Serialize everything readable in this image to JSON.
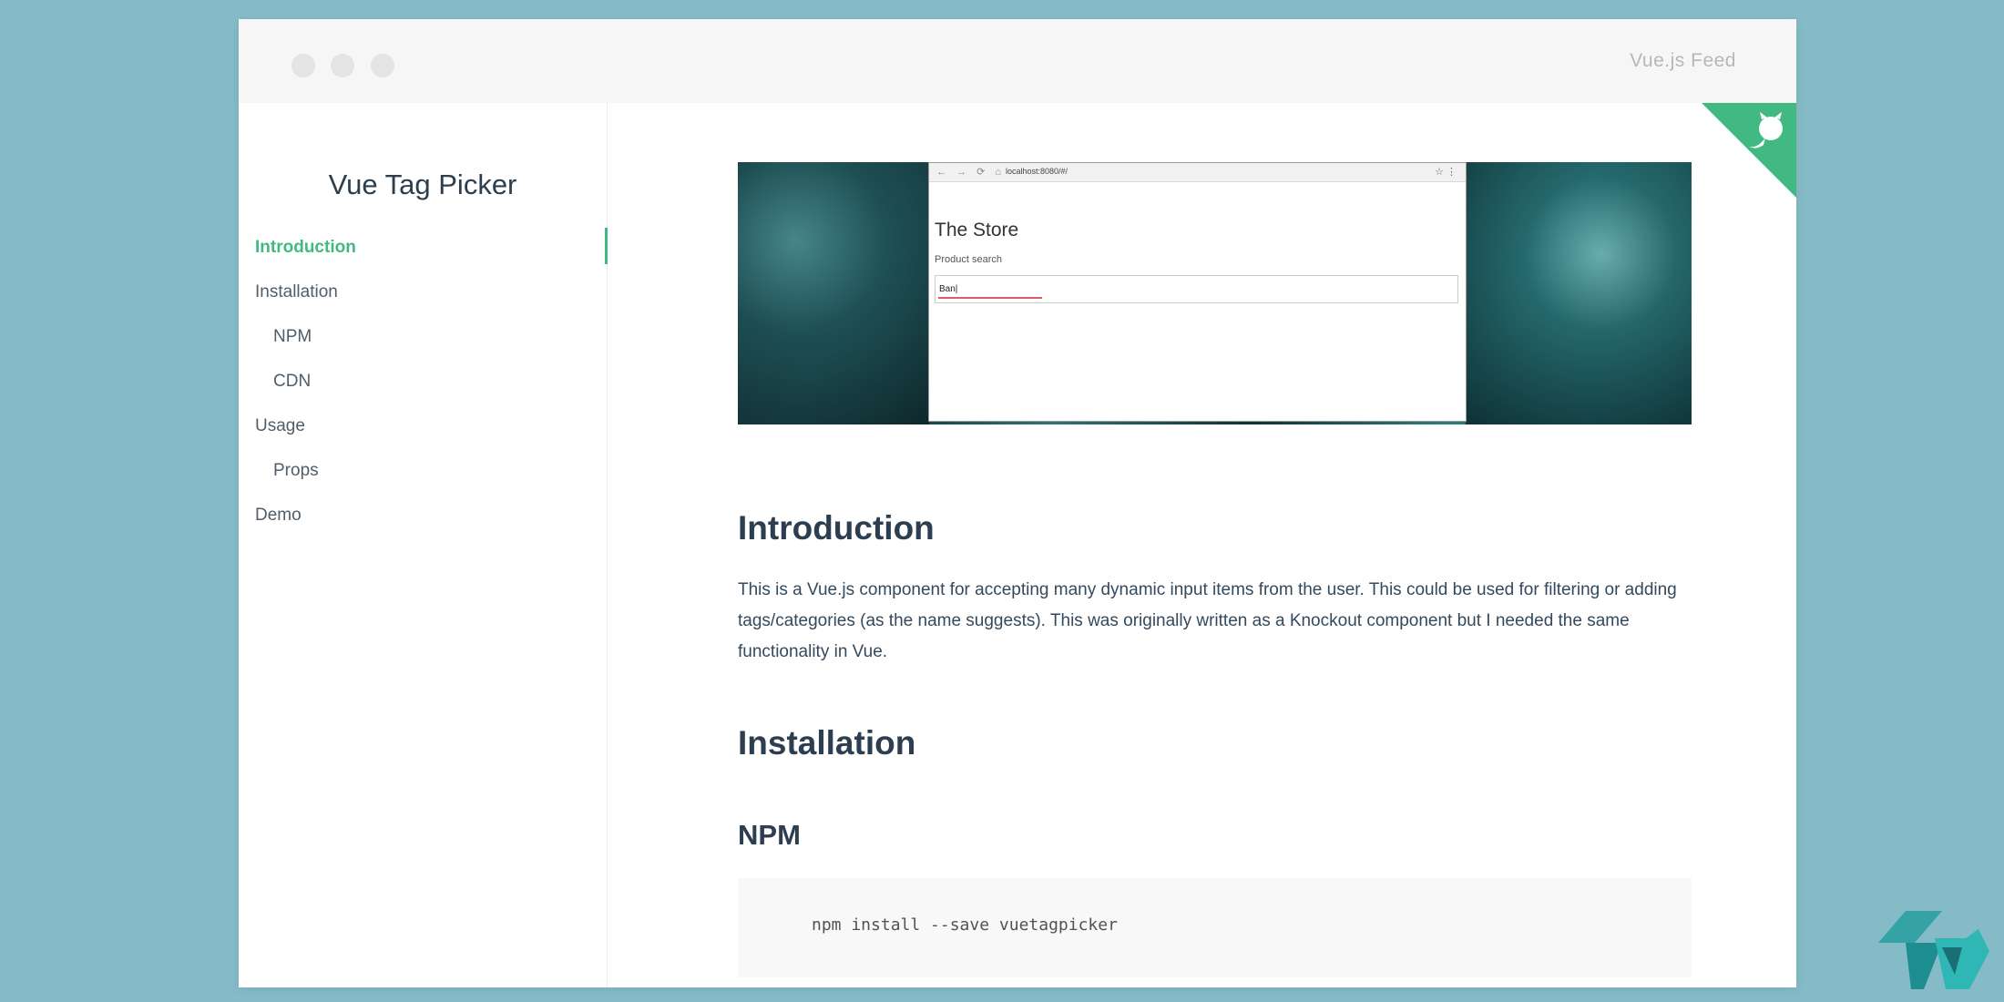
{
  "window": {
    "title": "Vue.js Feed"
  },
  "sidebar": {
    "title": "Vue Tag Picker",
    "items": [
      {
        "label": "Introduction",
        "level": 0,
        "active": true
      },
      {
        "label": "Installation",
        "level": 0,
        "active": false
      },
      {
        "label": "NPM",
        "level": 1,
        "active": false
      },
      {
        "label": "CDN",
        "level": 1,
        "active": false
      },
      {
        "label": "Usage",
        "level": 0,
        "active": false
      },
      {
        "label": "Props",
        "level": 1,
        "active": false
      },
      {
        "label": "Demo",
        "level": 0,
        "active": false
      }
    ]
  },
  "hero": {
    "browser": {
      "url": "localhost:8080/#/",
      "page_heading": "The Store",
      "field_label": "Product search",
      "field_value": "Ban|"
    }
  },
  "content": {
    "intro_heading": "Introduction",
    "intro_text": "This is a Vue.js component for accepting many dynamic input items from the user. This could be used for filtering or adding tags/categories (as the name suggests). This was originally written as a Knockout component but I needed the same functionality in Vue.",
    "install_heading": "Installation",
    "npm_heading": "NPM",
    "npm_command": "npm install --save vuetagpicker"
  },
  "icons": {
    "github_corner": "github-octocat-icon",
    "brand_logo": "vuejs-feed-logo"
  },
  "colors": {
    "accent": "#42b983",
    "heading": "#2c3e50",
    "background": "#84bbc7"
  }
}
